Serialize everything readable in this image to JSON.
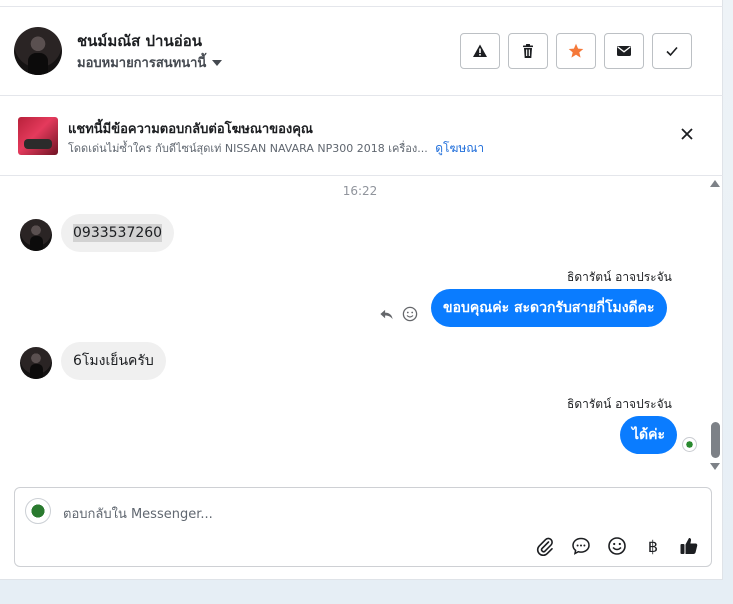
{
  "header": {
    "contact_name": "ชนม์มณัส ปานอ่อน",
    "assign_label": "มอบหมายการสนทนานี้",
    "buttons": [
      {
        "name": "report",
        "icon": "warning-icon"
      },
      {
        "name": "delete",
        "icon": "trash-icon"
      },
      {
        "name": "star",
        "icon": "star-icon",
        "color": "#f5793a"
      },
      {
        "name": "mark-unread",
        "icon": "envelope-icon"
      },
      {
        "name": "done",
        "icon": "check-icon"
      }
    ]
  },
  "ad_banner": {
    "title": "แชทนี้มีข้อความตอบกลับต่อโฆษณาของคุณ",
    "description": "โดดเด่นไม่ซ้ำใคร กับดีไซน์สุดเท่ NISSAN NAVARA NP300 2018 เครื่อง...",
    "link_label": "ดูโฆษณา"
  },
  "messages": {
    "timestamp": "16:22",
    "items": [
      {
        "direction": "in",
        "text": "0933537260"
      },
      {
        "direction": "out",
        "sender": "ธิดารัตน์ อาจประจัน",
        "text": "ขอบคุณค่ะ สะดวกรับสายกี่โมงดีคะ"
      },
      {
        "direction": "in",
        "text": "6โมงเย็นครับ"
      },
      {
        "direction": "out",
        "sender": "ธิดารัตน์ อาจประจัน",
        "text": "ได้ค่ะ"
      }
    ]
  },
  "composer": {
    "placeholder": "ตอบกลับใน Messenger...",
    "tools": [
      "paperclip-icon",
      "chat-bubble-icon",
      "emoji-icon",
      "baht-icon",
      "thumbs-up-icon"
    ],
    "baht_symbol": "฿"
  },
  "colors": {
    "outgoing_bubble": "#0a7cff",
    "incoming_bubble": "#f0f0f0",
    "link": "#216fdb",
    "star": "#f5793a"
  }
}
